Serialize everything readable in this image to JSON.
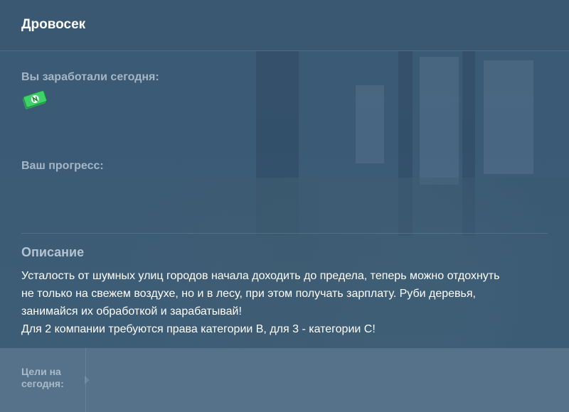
{
  "header": {
    "title": "Дровосек"
  },
  "earned": {
    "label": "Вы заработали сегодня:",
    "icon": "money-icon"
  },
  "progress": {
    "label": "Ваш прогресс:"
  },
  "description": {
    "heading": "Описание",
    "lines": [
      "Усталость от шумных улиц городов начала доходить до предела, теперь можно отдохнуть",
      "не только на свежем воздухе, но и в лесу, при этом получать зарплату. Руби деревья,",
      "занимайся их обработкой и зарабатывай!",
      "Для 2 компании требуются права категории B, для 3 - категории C!"
    ]
  },
  "footer": {
    "goals_label": "Цели на сегодня:"
  },
  "colors": {
    "header_bg": "#3a5871",
    "footer_bg": "#56728a",
    "money_green": "#3fd16a"
  }
}
